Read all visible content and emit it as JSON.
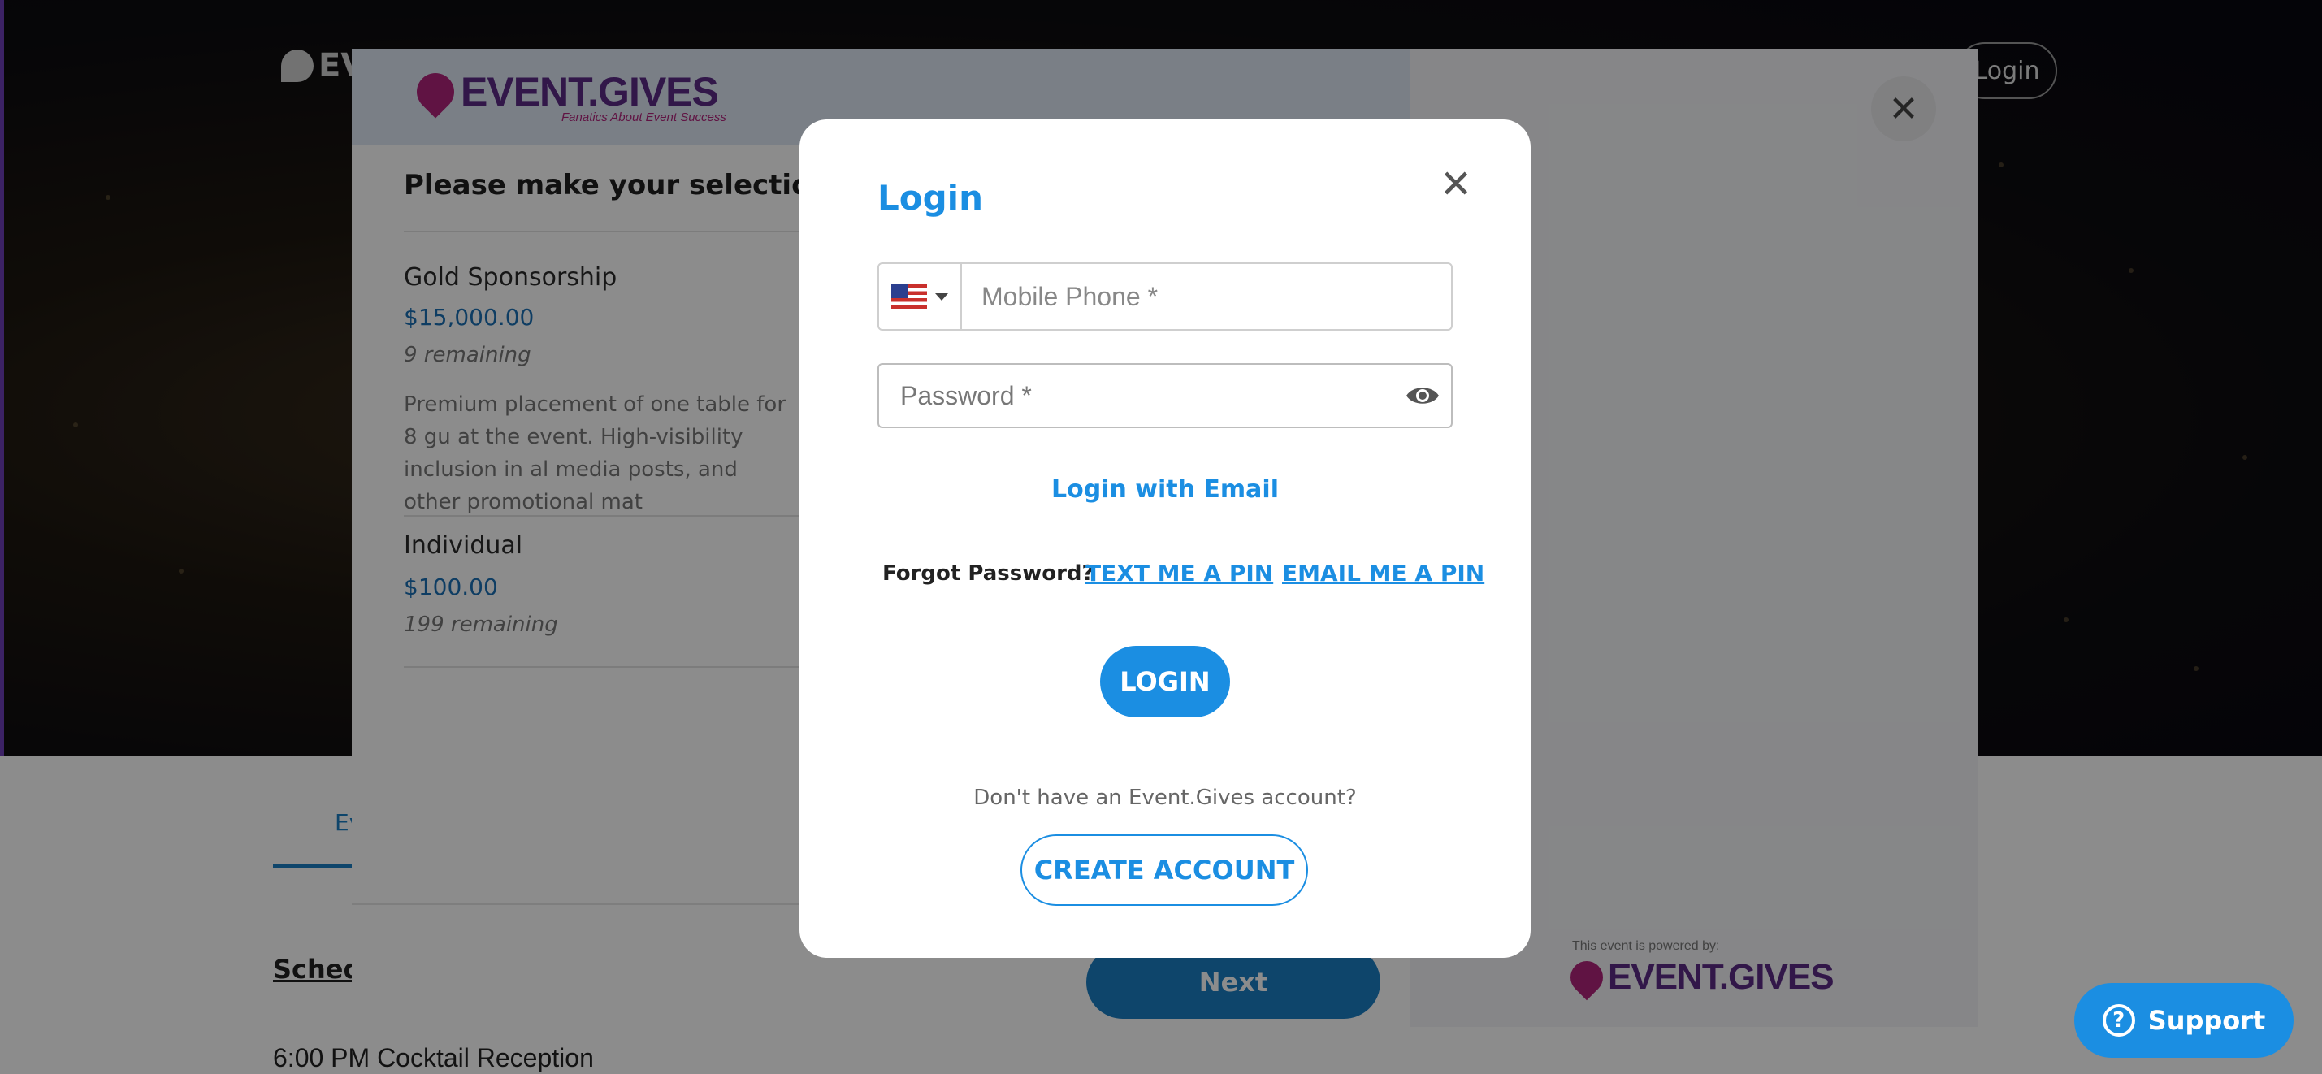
{
  "background": {
    "nav_logo_text": "EV",
    "nav_login_label": "Login",
    "tab_label": "Ev",
    "schedule_heading": "Sched",
    "schedule_item": "6:00 PM Cocktail Reception"
  },
  "selection_modal": {
    "logo_word": "EVENT.GIVES",
    "logo_tagline": "Fanatics About Event Success",
    "title": "Please make your selection(s",
    "items": [
      {
        "name": "Gold Sponsorship",
        "price": "$15,000.00",
        "remaining": "9 remaining",
        "description": "Premium placement of one table for 8 gu at the event. High-visibility inclusion in al media posts, and other promotional mat"
      },
      {
        "name": "Individual",
        "price": "$100.00",
        "remaining": "199 remaining"
      }
    ],
    "next_label": "Next",
    "powered_by_label": "This event is powered by:",
    "powered_by_word": "EVENT.GIVES"
  },
  "login_dialog": {
    "title": "Login",
    "close_glyph": "✕",
    "country_flag": "us-flag-icon",
    "phone_placeholder": "Mobile Phone *",
    "password_placeholder": "Password *",
    "login_with_email": "Login with Email",
    "forgot_label": "Forgot Password?",
    "text_pin": "TEXT ME A PIN",
    "email_pin": "EMAIL ME A PIN",
    "login_button": "LOGIN",
    "no_account": "Don't have an Event.Gives account?",
    "create_account": "CREATE ACCOUNT"
  },
  "support": {
    "label": "Support"
  },
  "colors": {
    "accent": "#1b8ee2",
    "brand_purple": "#5b2a86",
    "brand_magenta": "#b0237a"
  }
}
